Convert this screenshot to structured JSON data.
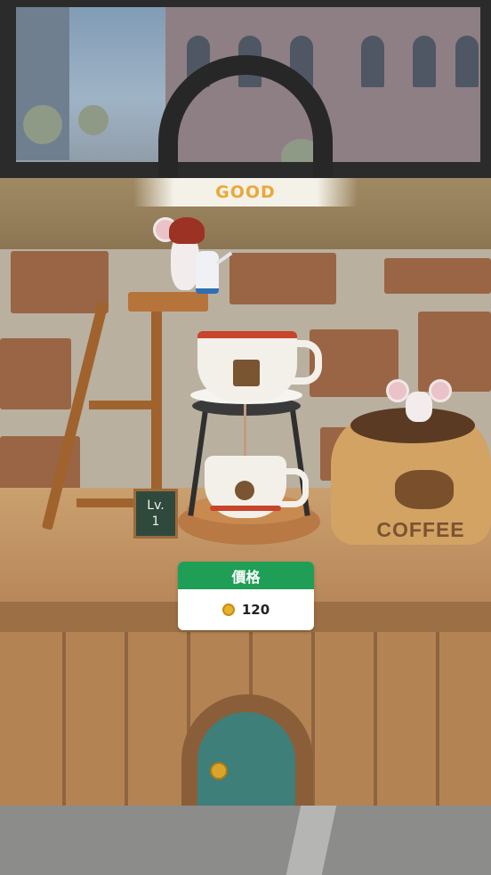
{
  "rating": {
    "label": "GOOD"
  },
  "level_sign": {
    "line1": "Lv.",
    "line2": "1"
  },
  "price": {
    "title": "價格",
    "amount": "120",
    "currency_icon": "coin-icon"
  },
  "sack": {
    "label": "COFFEE"
  },
  "colors": {
    "price_header": "#1f9e56",
    "rating_text": "#e8a93a",
    "door": "#3f7f7a",
    "coin": "#e9b02a"
  }
}
